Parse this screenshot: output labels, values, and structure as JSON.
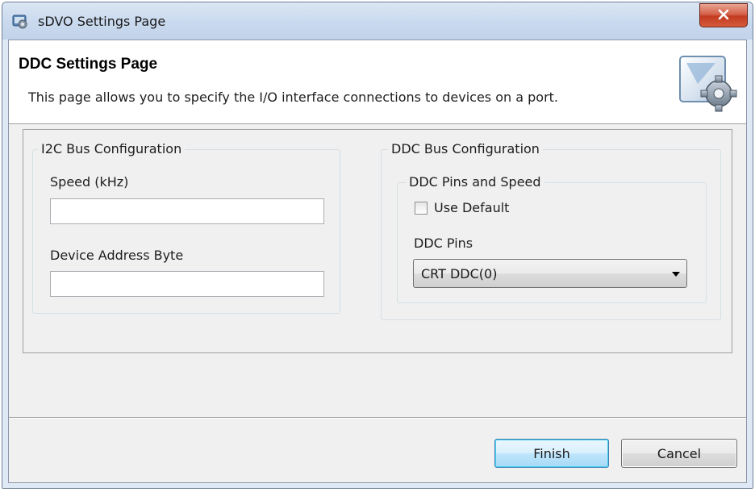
{
  "window": {
    "title": "sDVO Settings Page",
    "icons": {
      "app": "settings-app-icon",
      "close": "close-icon"
    }
  },
  "header": {
    "title": "DDC Settings Page",
    "description": "This page allows you to specify the I/O interface connections to devices on a port.",
    "icon": "gear-settings-icon"
  },
  "i2c_bus": {
    "group_title": "I2C Bus Configuration",
    "speed_label": "Speed (kHz)",
    "speed_value": "",
    "address_label": "Device Address Byte",
    "address_value": ""
  },
  "ddc_bus": {
    "group_title": "DDC Bus Configuration",
    "pins_speed_group_title": "DDC Pins and Speed",
    "use_default_label": "Use Default",
    "use_default_checked": false,
    "pins_label": "DDC Pins",
    "pins_selected": "CRT DDC(0)"
  },
  "buttons": {
    "finish": "Finish",
    "cancel": "Cancel"
  },
  "colors": {
    "title_bar": "#c9d9ee",
    "client_bg": "#f0f0f0",
    "close_button": "#c23a1f",
    "default_button_border": "#3c7fb1"
  }
}
